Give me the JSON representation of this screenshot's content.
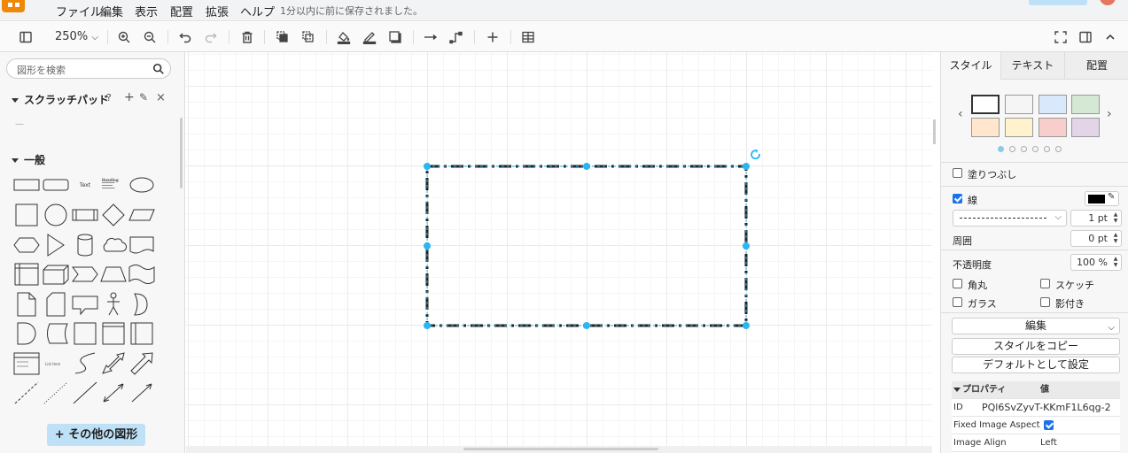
{
  "menu": {
    "items": [
      "ファイル",
      "編集",
      "表示",
      "配置",
      "拡張",
      "ヘルプ"
    ],
    "save_status": "1分以内に前に保存されました。"
  },
  "toolbar": {
    "zoom": "250%",
    "icons": [
      "sidebar-toggle-icon",
      "zoom-in-icon",
      "zoom-out-icon",
      "undo-icon",
      "redo-icon",
      "delete-icon",
      "to-front-icon",
      "to-back-icon",
      "fill-color-icon",
      "line-color-icon",
      "shadow-icon",
      "connection-icon",
      "waypoint-icon",
      "insert-icon",
      "table-icon",
      "fullscreen-icon",
      "format-panel-icon",
      "collapse-icon"
    ]
  },
  "left_panel": {
    "search_placeholder": "図形を検索",
    "scratchpad": "スクラッチパッド",
    "scratchpad_empty": "—",
    "general": "一般",
    "shape_text_label": "Text",
    "shape_heading_label": "Heading",
    "shape_list_label": "List Item",
    "more_shapes": "その他の図形"
  },
  "right_panel": {
    "tabs": [
      "スタイル",
      "テキスト",
      "配置"
    ],
    "swatches": [
      "#ffffff",
      "#f5f5f5",
      "#dae8fc",
      "#d5e8d4",
      "#ffe6cc",
      "#fff2cc",
      "#f8cecc",
      "#e1d5e7"
    ],
    "fill_label": "塗りつぶし",
    "line_label": "線",
    "line_color": "#000000",
    "line_width": "1 pt",
    "perimeter_label": "周囲",
    "perimeter_value": "0 pt",
    "opacity_label": "不透明度",
    "opacity_value": "100 %",
    "rounded_label": "角丸",
    "sketch_label": "スケッチ",
    "glass_label": "ガラス",
    "shadow_label": "影付き",
    "edit_label": "編集",
    "copy_style": "スタイルをコピー",
    "set_default": "デフォルトとして設定",
    "properties_header": "プロパティ",
    "value_header": "値",
    "props": [
      {
        "key": "ID",
        "value": "PQl6SvZyvT-KKmF1L6qg-2"
      },
      {
        "key": "Fixed Image Aspect",
        "value": ""
      },
      {
        "key": "Image Align",
        "value": "Left"
      }
    ]
  },
  "accent_color": "#29b6f2"
}
